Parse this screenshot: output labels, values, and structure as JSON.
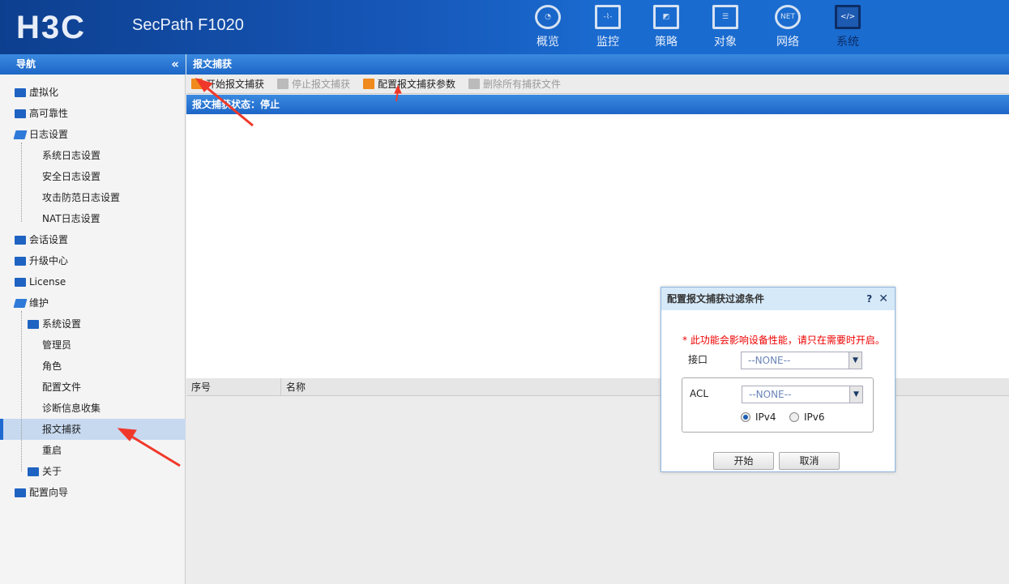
{
  "header": {
    "logo": "H3C",
    "product": "SecPath F1020",
    "nav": [
      {
        "label": "概览",
        "icon": "dashboard-gauge-icon"
      },
      {
        "label": "监控",
        "icon": "monitor-icon"
      },
      {
        "label": "策略",
        "icon": "shield-icon"
      },
      {
        "label": "对象",
        "icon": "server-stack-icon"
      },
      {
        "label": "网络",
        "icon": "internet-globe-icon"
      },
      {
        "label": "系统",
        "icon": "code-window-icon",
        "active": true
      }
    ]
  },
  "sidebar": {
    "title": "导航",
    "collapse": "«",
    "items": [
      {
        "label": "虚拟化",
        "level": 0,
        "type": "folder"
      },
      {
        "label": "高可靠性",
        "level": 0,
        "type": "folder"
      },
      {
        "label": "日志设置",
        "level": 0,
        "type": "folder-open"
      },
      {
        "label": "系统日志设置",
        "level": 1,
        "type": "leaf"
      },
      {
        "label": "安全日志设置",
        "level": 1,
        "type": "leaf"
      },
      {
        "label": "攻击防范日志设置",
        "level": 1,
        "type": "leaf"
      },
      {
        "label": "NAT日志设置",
        "level": 1,
        "type": "leaf"
      },
      {
        "label": "会话设置",
        "level": 0,
        "type": "folder"
      },
      {
        "label": "升级中心",
        "level": 0,
        "type": "folder"
      },
      {
        "label": "License",
        "level": 0,
        "type": "folder"
      },
      {
        "label": "维护",
        "level": 0,
        "type": "folder-open"
      },
      {
        "label": "系统设置",
        "level": 1,
        "type": "folder"
      },
      {
        "label": "管理员",
        "level": 1,
        "type": "leaf"
      },
      {
        "label": "角色",
        "level": 1,
        "type": "leaf"
      },
      {
        "label": "配置文件",
        "level": 1,
        "type": "leaf"
      },
      {
        "label": "诊断信息收集",
        "level": 1,
        "type": "leaf"
      },
      {
        "label": "报文捕获",
        "level": 1,
        "type": "leaf",
        "selected": true
      },
      {
        "label": "重启",
        "level": 1,
        "type": "leaf"
      },
      {
        "label": "关于",
        "level": 1,
        "type": "folder"
      },
      {
        "label": "配置向导",
        "level": 0,
        "type": "folder"
      }
    ]
  },
  "main": {
    "title": "报文捕获",
    "toolbar": [
      {
        "label": "开始报文捕获",
        "enabled": true
      },
      {
        "label": "停止报文捕获",
        "enabled": false
      },
      {
        "label": "配置报文捕获参数",
        "enabled": true
      },
      {
        "label": "删除所有捕获文件",
        "enabled": false
      }
    ],
    "status": "报文捕获状态：停止",
    "columns": [
      "序号",
      "名称"
    ]
  },
  "dialog": {
    "title": "配置报文捕获过滤条件",
    "help": "?",
    "close": "✕",
    "warning": "* 此功能会影响设备性能，请只在需要时开启。",
    "interface_label": "接口",
    "interface_value": "--NONE--",
    "acl_label": "ACL",
    "acl_value": "--NONE--",
    "ipv4": "IPv4",
    "ipv6": "IPv6",
    "selected_ip": "IPv4",
    "start": "开始",
    "cancel": "取消"
  },
  "colors": {
    "header": "#1a6bd0",
    "accent": "#1e6ad0",
    "warning": "#e00000",
    "annotation_arrow": "#f0382a"
  }
}
